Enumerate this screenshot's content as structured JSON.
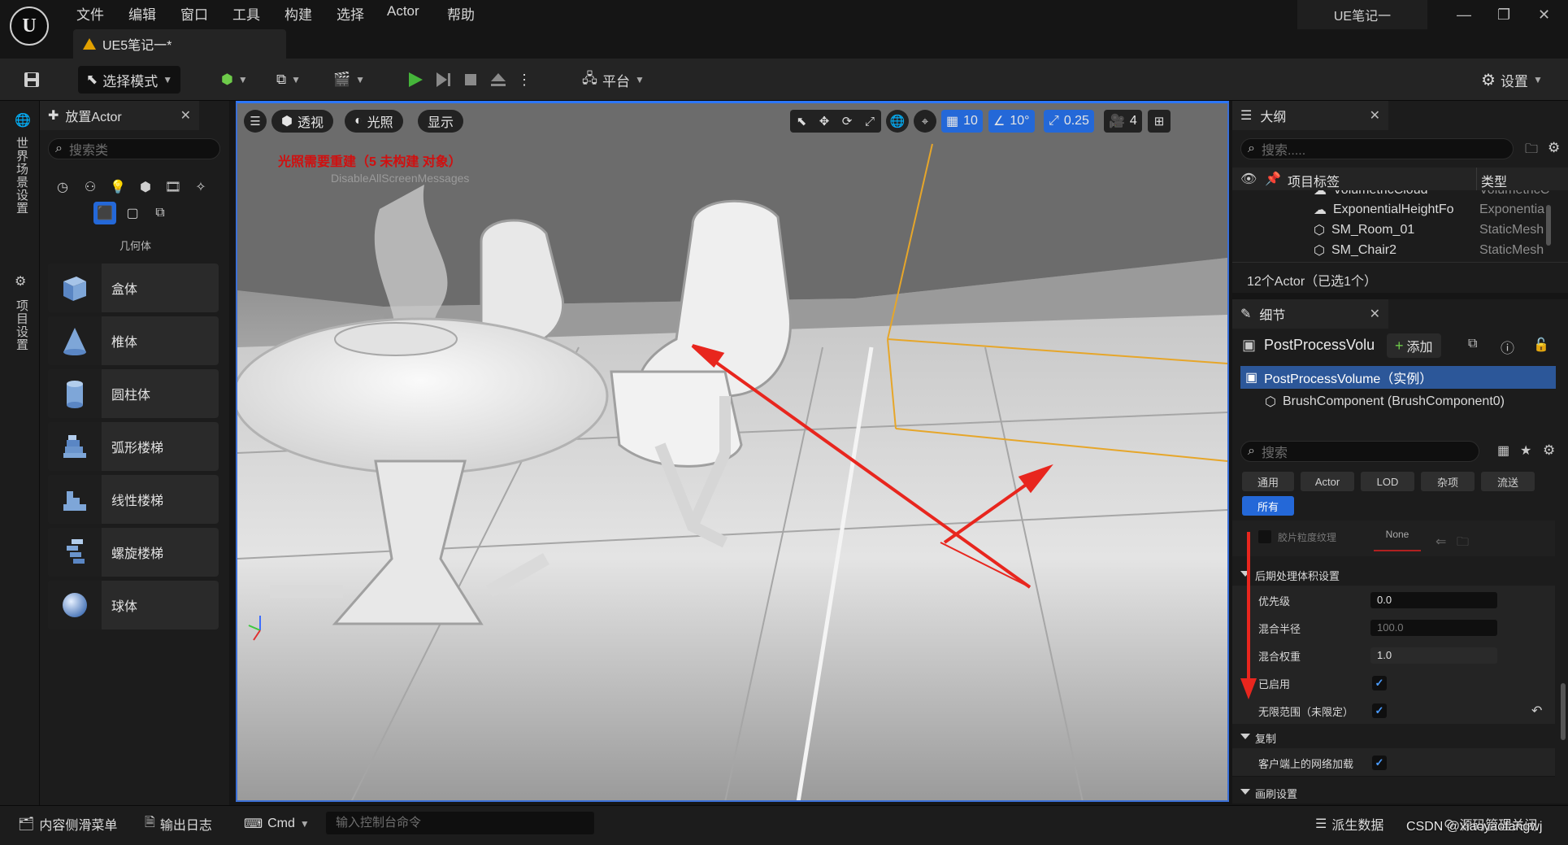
{
  "menu": [
    "文件",
    "编辑",
    "窗口",
    "工具",
    "构建",
    "选择",
    "Actor",
    "帮助"
  ],
  "document_tab": "UE5笔记一*",
  "project_name": "UE笔记一",
  "toolbar": {
    "select_mode": "选择模式",
    "platform": "平台",
    "settings": "设置"
  },
  "left_strip": {
    "world_settings": "世界场景设置",
    "project_settings": "项目设置"
  },
  "place_actor": {
    "title": "放置Actor",
    "search_placeholder": "搜索类",
    "category_label": "几何体",
    "items": [
      "盒体",
      "椎体",
      "圆柱体",
      "弧形楼梯",
      "线性楼梯",
      "螺旋楼梯",
      "球体"
    ]
  },
  "viewport": {
    "perspective": "透视",
    "lighting": "光照",
    "show": "显示",
    "grid_snap": "10",
    "rotation_snap": "10°",
    "scale_snap": "0.25",
    "camera_speed": "4",
    "lighting_warning": "光照需要重建（5 未构建 对象）",
    "disable_message": "DisableAllScreenMessages"
  },
  "outliner": {
    "title": "大纲",
    "search_placeholder": "搜索.....",
    "col_label": "项目标签",
    "col_type": "类型",
    "rows": [
      {
        "name": "VolumetricCloud",
        "type": "VolumetricC"
      },
      {
        "name": "ExponentialHeightFo",
        "type": "Exponentia"
      },
      {
        "name": "SM_Room_01",
        "type": "StaticMesh"
      },
      {
        "name": "SM_Chair2",
        "type": "StaticMesh"
      }
    ],
    "count": "12个Actor（已选1个）"
  },
  "details": {
    "title": "细节",
    "actor_name": "PostProcessVolu",
    "add_label": "添加",
    "instance_label": "PostProcessVolume（实例）",
    "component_label": "BrushComponent (BrushComponent0)",
    "search_placeholder": "搜索",
    "filters": [
      "通用",
      "Actor",
      "LOD",
      "杂项",
      "流送"
    ],
    "filter_all": "所有",
    "film_grain_label": "胶片粒度纹理",
    "film_grain_value": "None",
    "section_post": "后期处理体积设置",
    "priority_label": "优先级",
    "priority_value": "0.0",
    "blend_radius_label": "混合半径",
    "blend_radius_value": "100.0",
    "blend_weight_label": "混合权重",
    "blend_weight_value": "1.0",
    "enabled_label": "已启用",
    "unbound_label": "无限范围（未限定）",
    "section_replication": "复制",
    "net_load_label": "客户端上的网络加载",
    "section_brush": "画刷设置"
  },
  "statusbar": {
    "content_drawer": "内容侧滑菜单",
    "output_log": "输出日志",
    "cmd": "Cmd",
    "console_placeholder": "输入控制台命令",
    "derived_data": "派生数据",
    "source_control": "源码管理关闭"
  },
  "watermark": "CSDN @xiaoyaofangwj",
  "colors": {
    "accent": "#2468d8",
    "warning_text": "#d01010",
    "annotation_arrow": "#e8261e",
    "selection_box": "#e6a62a"
  }
}
